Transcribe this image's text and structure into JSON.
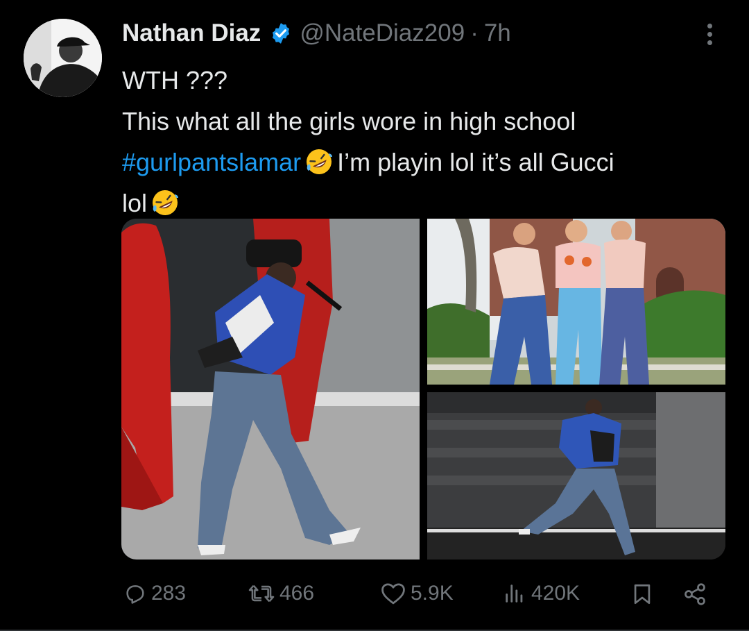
{
  "tweet": {
    "author_name": "Nathan Diaz",
    "handle": "@NateDiaz209",
    "separator": "·",
    "time": "7h",
    "verified_icon": "verified-badge-icon",
    "text_lines": {
      "line1": "WTH ???",
      "line2": "This what all the girls wore in high school",
      "line3_hashtag": "#gurlpantslamar",
      "line3_rest": "I’m playin lol it’s all Gucci",
      "line4": "lol"
    },
    "emoji": "rolling-on-floor-laughing-emoji"
  },
  "media": {
    "photos": [
      "photo-performer-mic-red-figures",
      "photo-three-women-flared-pants",
      "photo-performer-dancing-stage"
    ]
  },
  "actions": {
    "replies": "283",
    "reposts": "466",
    "likes": "5.9K",
    "views": "420K"
  },
  "colors": {
    "background": "#000000",
    "text": "#e7e9ea",
    "muted": "#71767b",
    "accent": "#1d9bf0"
  }
}
